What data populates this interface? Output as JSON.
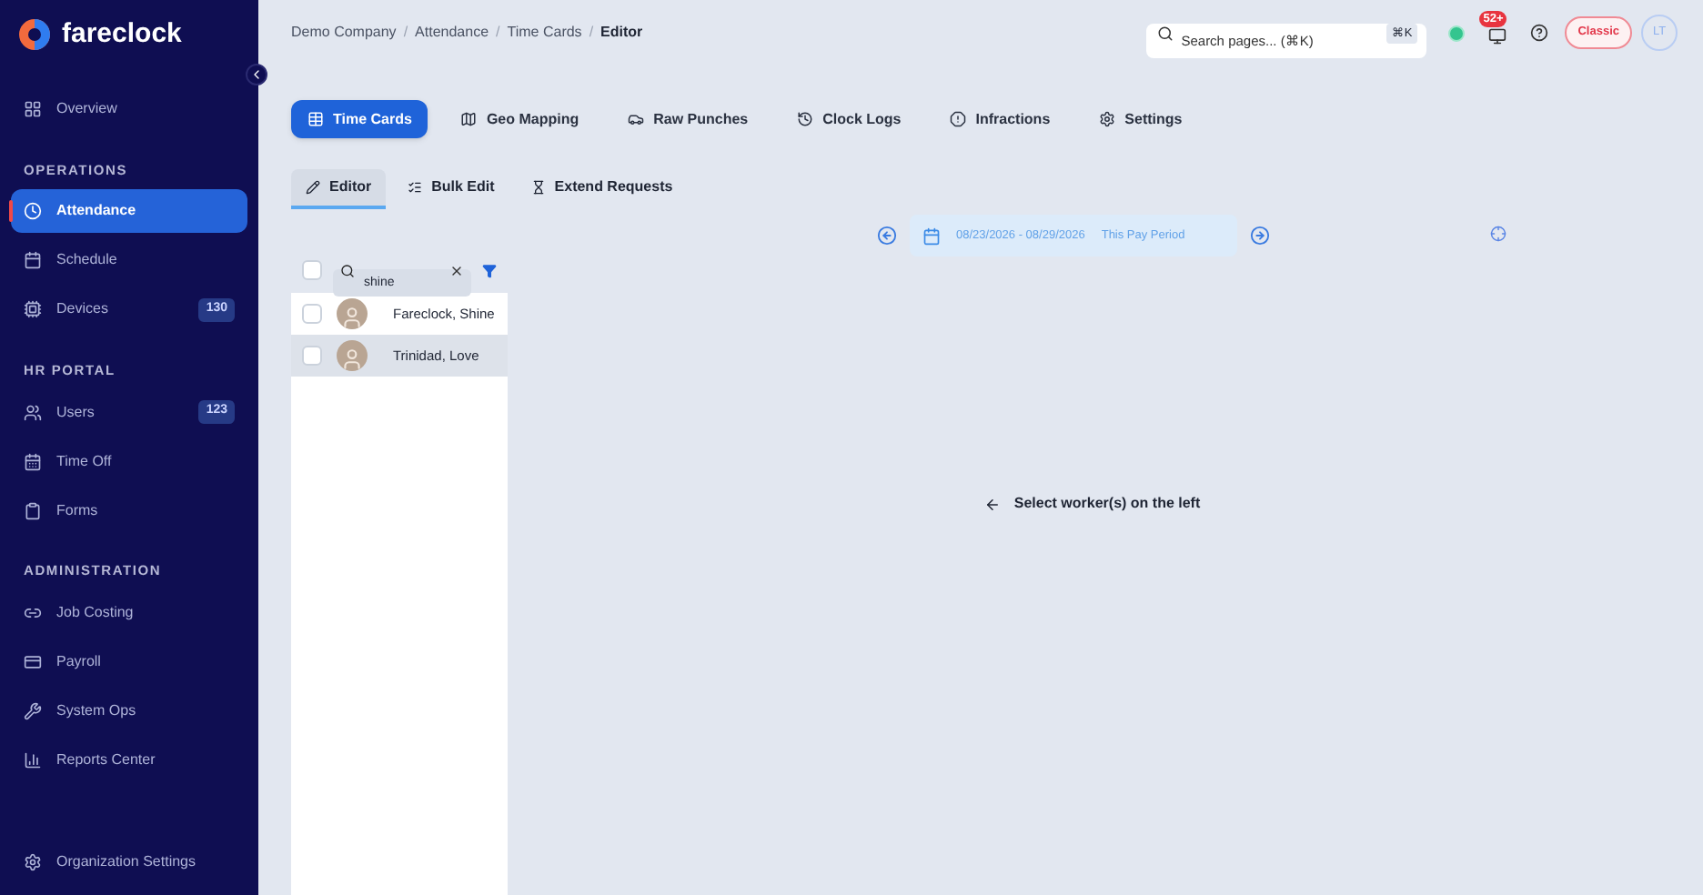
{
  "brand": {
    "name": "fareclock"
  },
  "sidebar": {
    "items": [
      {
        "kind": "item",
        "label": "Overview",
        "selected": false
      },
      {
        "kind": "heading",
        "label": "OPERATIONS"
      },
      {
        "kind": "item",
        "label": "Attendance",
        "selected": true
      },
      {
        "kind": "item",
        "label": "Schedule",
        "selected": false
      },
      {
        "kind": "item",
        "label": "Devices",
        "selected": false,
        "count": "130"
      },
      {
        "kind": "heading",
        "label": "HR PORTAL"
      },
      {
        "kind": "item",
        "label": "Users",
        "selected": false,
        "count": "123"
      },
      {
        "kind": "item",
        "label": "Time Off",
        "selected": false
      },
      {
        "kind": "item",
        "label": "Forms",
        "selected": false
      },
      {
        "kind": "heading",
        "label": "ADMINISTRATION"
      },
      {
        "kind": "item",
        "label": "Job Costing",
        "selected": false
      },
      {
        "kind": "item",
        "label": "Payroll",
        "selected": false
      },
      {
        "kind": "item",
        "label": "System Ops",
        "selected": false
      },
      {
        "kind": "item",
        "label": "Reports Center",
        "selected": false
      }
    ],
    "footer": "Organization Settings"
  },
  "breadcrumb": [
    "Demo Company",
    "Attendance",
    "Time Cards",
    "Editor"
  ],
  "breadcrumb_separator": "/",
  "search": {
    "placeholder": "Search pages... (⌘K)",
    "shortcut": "⌘K"
  },
  "notifications": {
    "count": "52+"
  },
  "mode_badge": "Classic",
  "avatar": "LT",
  "tabs": [
    {
      "label": "Time Cards",
      "selected": true
    },
    {
      "label": "Geo Mapping",
      "selected": false
    },
    {
      "label": "Raw Punches",
      "selected": false
    },
    {
      "label": "Clock Logs",
      "selected": false
    },
    {
      "label": "Infractions",
      "selected": false
    },
    {
      "label": "Settings",
      "selected": false
    }
  ],
  "subtabs": [
    {
      "label": "Editor",
      "selected": true
    },
    {
      "label": "Bulk Edit",
      "selected": false
    },
    {
      "label": "Extend Requests",
      "selected": false
    }
  ],
  "worker_search": {
    "value": "shine",
    "select_all_checked": false
  },
  "workers": [
    {
      "name": "Fareclock, Shine",
      "checked": false,
      "selected": false
    },
    {
      "name": "Trinidad, Love",
      "checked": false,
      "selected": true
    }
  ],
  "period": {
    "range": "08/23/2026 - 08/29/2026",
    "label": "This Pay Period"
  },
  "empty_message": "Select worker(s) on the left"
}
